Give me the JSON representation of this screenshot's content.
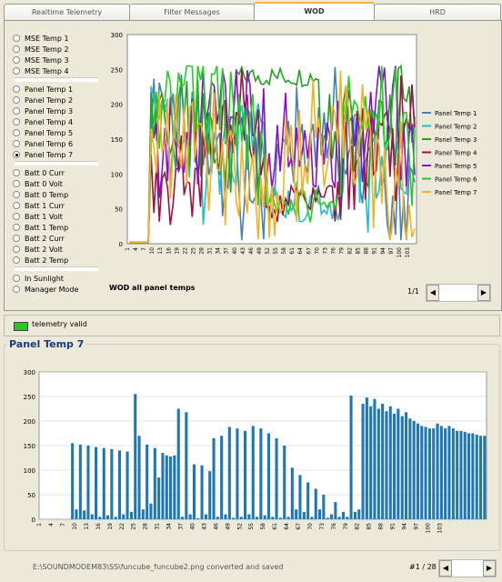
{
  "tabs": [
    "Realtime Telemetry",
    "Filter Messages",
    "WOD",
    "HRD"
  ],
  "active_tab": 2,
  "radio_groups": [
    [
      "MSE Temp 1",
      "MSE Temp 2",
      "MSE Temp 3",
      "MSE Temp 4"
    ],
    [
      "Panel Temp 1",
      "Panel Temp 2",
      "Panel Temp 3",
      "Panel Temp 4",
      "Panel Temp 5",
      "Panel Temp 6",
      "Panel Temp 7"
    ],
    [
      "Batt 0 Curr",
      "Batt 0 Volt",
      "Batt 0 Temp",
      "Batt 1 Curr",
      "Batt 1 Volt",
      "Batt 1 Temp",
      "Batt 2 Curr",
      "Batt 2 Volt",
      "Batt 2 Temp"
    ],
    [
      "In Sunlight",
      "Manager Mode"
    ]
  ],
  "selected_radio": "Panel Temp 7",
  "wod": {
    "caption": "WOD all panel temps",
    "page": "1/1"
  },
  "status": {
    "label": "telemetry valid",
    "led_color": "#22cc22"
  },
  "group_title": "Panel Temp 7",
  "footer": {
    "path": "E:\\SOUNDMODEM83\\SS\\funcube_funcube2.png converted and saved",
    "page": "#1 / 28"
  },
  "chart_data": [
    {
      "type": "line",
      "y_ticks": [
        0,
        50,
        100,
        150,
        200,
        250,
        300
      ],
      "ylim": [
        0,
        300
      ],
      "legend_position": "right",
      "series": [
        {
          "name": "Panel Temp 1",
          "color": "#4682b4"
        },
        {
          "name": "Panel Temp 2",
          "color": "#20c0c8"
        },
        {
          "name": "Panel Temp 3",
          "color": "#22a022"
        },
        {
          "name": "Panel Temp 4",
          "color": "#a01040"
        },
        {
          "name": "Panel Temp 5",
          "color": "#8a10c8"
        },
        {
          "name": "Panel Temp 6",
          "color": "#22cc22"
        },
        {
          "name": "Panel Temp 7",
          "color": "#f8b020"
        }
      ]
    },
    {
      "type": "bar",
      "title": "Panel Temp 7",
      "ylim": [
        0,
        300
      ],
      "y_ticks": [
        0,
        50,
        100,
        150,
        200,
        250,
        300
      ],
      "x_tick_labels": [
        "1",
        "4",
        "7",
        "10",
        "13",
        "16",
        "19",
        "22",
        "25",
        "28",
        "31",
        "34",
        "37",
        "40",
        "43",
        "46",
        "49",
        "52",
        "55",
        "58",
        "61",
        "64",
        "67",
        "70",
        "73",
        "76",
        "79",
        "82",
        "85",
        "88",
        "91",
        "94",
        "97",
        "100",
        "103"
      ],
      "values": [
        0,
        0,
        0,
        0,
        0,
        0,
        0,
        0,
        155,
        20,
        152,
        18,
        150,
        10,
        147,
        5,
        145,
        8,
        143,
        5,
        140,
        10,
        138,
        15,
        255,
        170,
        20,
        152,
        32,
        145,
        85,
        135,
        130,
        128,
        130,
        225,
        5,
        218,
        10,
        112,
        2,
        110,
        10,
        98,
        165,
        5,
        170,
        10,
        188,
        3,
        185,
        5,
        180,
        10,
        190,
        5,
        185,
        8,
        175,
        5,
        165,
        3,
        150,
        5,
        105,
        20,
        90,
        15,
        75,
        5,
        62,
        20,
        50,
        3,
        10,
        35,
        5,
        15,
        5,
        252,
        15,
        20,
        235,
        248,
        230,
        245,
        225,
        235,
        220,
        230,
        215,
        225,
        210,
        218,
        205,
        200,
        195,
        190,
        188,
        185,
        185,
        195,
        190,
        185,
        190,
        185,
        180,
        180,
        178,
        175,
        175,
        172,
        170,
        170
      ],
      "bar_color": "#1f78b4"
    }
  ]
}
